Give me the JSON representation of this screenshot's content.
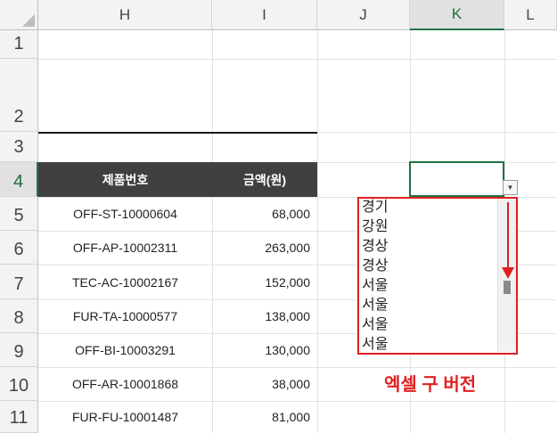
{
  "columns": [
    "H",
    "I",
    "J",
    "K",
    "L"
  ],
  "rows": [
    "1",
    "2",
    "3",
    "4",
    "5",
    "6",
    "7",
    "8",
    "9",
    "10",
    "11"
  ],
  "table": {
    "headers": [
      "제품번호",
      "금액(원)"
    ],
    "rows": [
      [
        "OFF-ST-10000604",
        "68,000"
      ],
      [
        "OFF-AP-10002311",
        "263,000"
      ],
      [
        "TEC-AC-10002167",
        "152,000"
      ],
      [
        "FUR-TA-10000577",
        "138,000"
      ],
      [
        "OFF-BI-10003291",
        "130,000"
      ],
      [
        "OFF-AR-10001868",
        "38,000"
      ],
      [
        "FUR-FU-10001487",
        "81,000"
      ]
    ]
  },
  "dropdown": {
    "items": [
      "경기",
      "강원",
      "경상",
      "경상",
      "서울",
      "서울",
      "서울",
      "서울"
    ],
    "button_glyph": "▼"
  },
  "annotation": "엑셀 구 버전",
  "colors": {
    "header_bg": "#404040",
    "selection": "#217346",
    "annotation": "#e02020"
  }
}
